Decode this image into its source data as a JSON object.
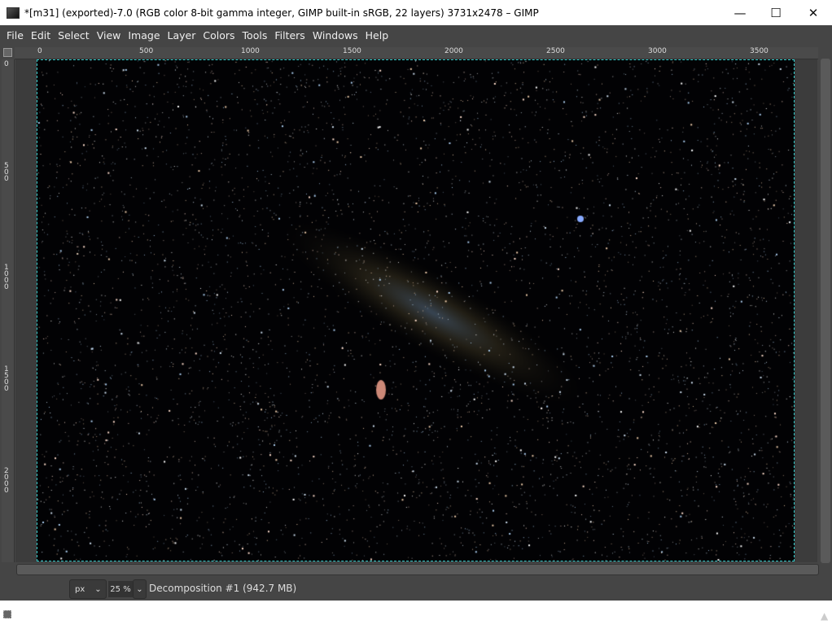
{
  "window": {
    "title": "*[m31] (exported)-7.0 (RGB color 8-bit gamma integer, GIMP built-in sRGB, 22 layers) 3731x2478 – GIMP",
    "minimize": "—",
    "maximize": "☐",
    "close": "✕"
  },
  "menu": [
    "File",
    "Edit",
    "Select",
    "View",
    "Image",
    "Layer",
    "Colors",
    "Tools",
    "Filters",
    "Windows",
    "Help"
  ],
  "hruler": [
    "0",
    "500",
    "1000",
    "1500",
    "2000",
    "2500",
    "3000",
    "3500"
  ],
  "vruler": [
    "0",
    "500",
    "1000",
    "1500",
    "2000"
  ],
  "status": {
    "unit": "px",
    "unit_arrow": "⌄",
    "zoom": "25 %",
    "zoom_arrow": "⌄",
    "text": "Decomposition #1 (942.7 MB)"
  }
}
